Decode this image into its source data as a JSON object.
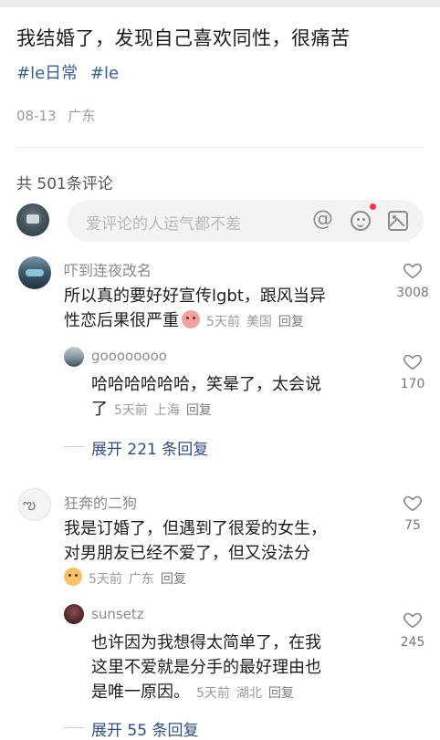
{
  "post": {
    "title": "我结婚了，发现自己喜欢同性，很痛苦",
    "tags": [
      "#le日常",
      "#le"
    ],
    "date": "08-13",
    "location": "广东"
  },
  "comments_header": {
    "count_label": "共 501条评论"
  },
  "input": {
    "placeholder": "爱评论的人运气都不差"
  },
  "icons": [
    "at-icon",
    "emoji-icon",
    "image-icon",
    "heart-icon"
  ],
  "comments": [
    {
      "user": "吓到连夜改名",
      "lines": [
        "所以真的要好好宣传lgbt，跟风当异",
        "性恋后果很严重"
      ],
      "time": "5天前",
      "location": "美国",
      "reply": "回复",
      "likes": "3008",
      "replies": [
        {
          "user": "goooooooo",
          "lines": [
            "哈哈哈哈哈哈，笑晕了，太会说",
            "了"
          ],
          "time": "5天前",
          "location": "上海",
          "reply": "回复",
          "likes": "170"
        }
      ],
      "expand_label": "展开 221 条回复"
    },
    {
      "user": "狂奔的二狗",
      "lines": [
        "我是订婚了，但遇到了很爱的女生，",
        "对男朋友已经不爱了，但又没法分"
      ],
      "time": "5天前",
      "location": "广东",
      "reply": "回复",
      "likes": "75",
      "replies": [
        {
          "user": "sunsetz",
          "lines": [
            "也许因为我想得太简单了，在我",
            "这里不爱就是分手的最好理由也",
            "是唯一原因。"
          ],
          "time": "5天前",
          "location": "湖北",
          "reply": "回复",
          "likes": "245"
        }
      ],
      "expand_label": "展开 55 条回复"
    }
  ],
  "colors": {
    "link_blue": "#2f4f7f",
    "tag_blue": "#3b5f8f",
    "badge_red": "#ff2d55"
  }
}
